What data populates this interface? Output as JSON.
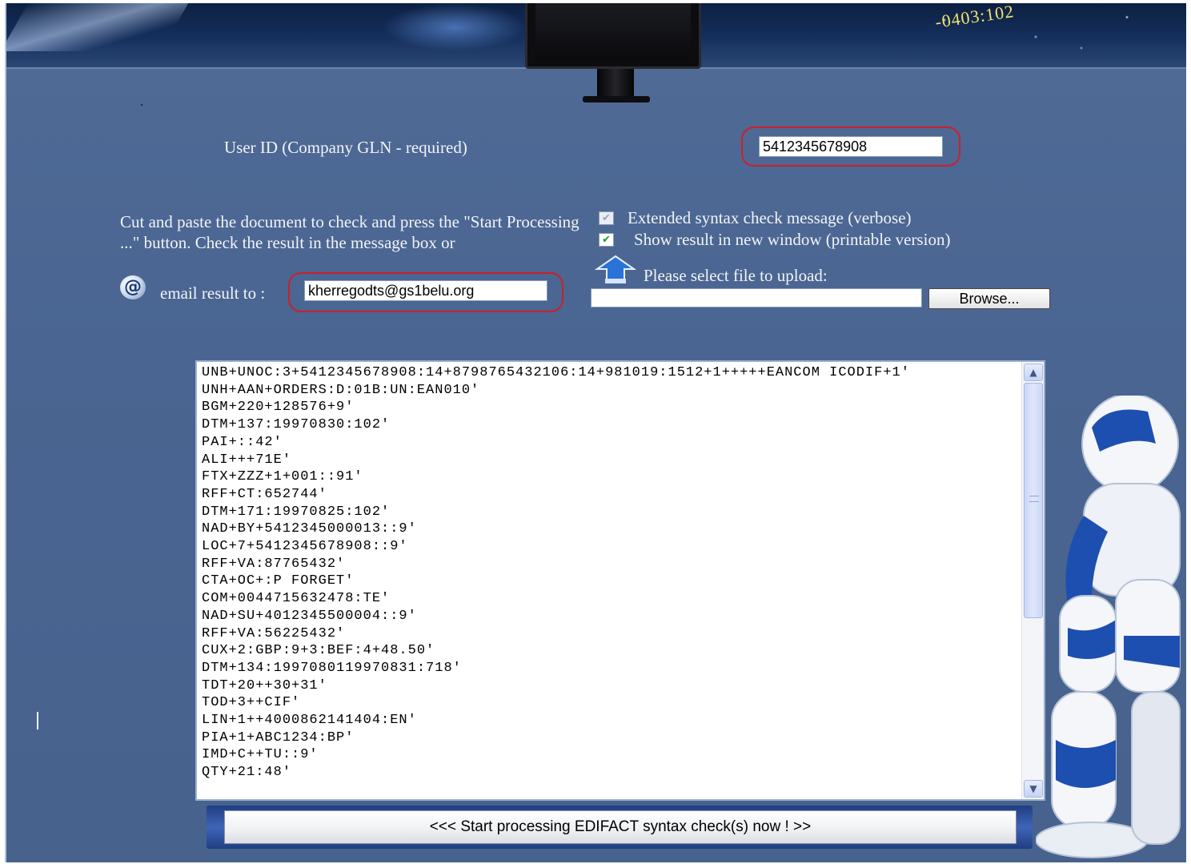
{
  "banner": {
    "code_text": "-0403:102"
  },
  "form": {
    "user_id_label": "User ID (Company GLN - required)",
    "user_id_value": "5412345678908",
    "instructions": "Cut and paste the document to check and press the \"Start Processing ...\" button. Check the result in the message box or",
    "email_label": "email result to :",
    "email_value": "kherregodts@gs1belu.org",
    "option_verbose_label": "Extended syntax check message (verbose)",
    "option_verbose_checked": true,
    "option_new_window_label": "Show result in new window (printable version)",
    "option_new_window_checked": true,
    "upload_label": "Please select file to upload:",
    "browse_label": "Browse...",
    "file_value": ""
  },
  "document": {
    "text": "UNB+UNOC:3+5412345678908:14+8798765432106:14+981019:1512+1+++++EANCOM ICODIF+1'\nUNH+AAN+ORDERS:D:01B:UN:EAN010'\nBGM+220+128576+9'\nDTM+137:19970830:102'\nPAI+::42'\nALI+++71E'\nFTX+ZZZ+1+001::91'\nRFF+CT:652744'\nDTM+171:19970825:102'\nNAD+BY+5412345000013::9'\nLOC+7+5412345678908::9'\nRFF+VA:87765432'\nCTA+OC+:P FORGET'\nCOM+0044715632478:TE'\nNAD+SU+4012345500004::9'\nRFF+VA:56225432'\nCUX+2:GBP:9+3:BEF:4+48.50'\nDTM+134:1997080119970831:718'\nTDT+20++30+31'\nTOD+3++CIF'\nLIN+1++4000862141404:EN'\nPIA+1+ABC1234:BP'\nIMD+C++TU::9'\nQTY+21:48'"
  },
  "actions": {
    "start_label": "<<< Start processing EDIFACT syntax check(s) now ! >>"
  },
  "colors": {
    "page_bg": "#4a6591",
    "highlight": "#cc1f2a",
    "checkbox_check": "#1c9a32"
  },
  "icons": {
    "email": "at-sign-icon",
    "upload": "upload-arrow-icon"
  }
}
